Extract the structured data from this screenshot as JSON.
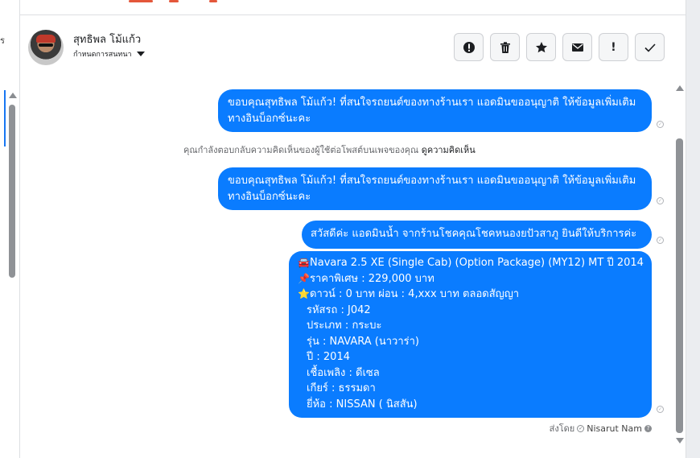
{
  "left_panel": {
    "clipped_text": "ร"
  },
  "header": {
    "user_name": "สุทธิพล โม้แก้ว",
    "assign_label": "กำหนดการสนทนา",
    "actions": [
      {
        "name": "spam-button",
        "icon": "exclamation-circle-icon"
      },
      {
        "name": "delete-button",
        "icon": "trash-icon"
      },
      {
        "name": "star-button",
        "icon": "star-icon"
      },
      {
        "name": "mark-unread-button",
        "icon": "envelope-icon"
      },
      {
        "name": "follow-up-button",
        "icon": "exclamation-icon",
        "glyph": "!"
      },
      {
        "name": "mark-done-button",
        "icon": "check-icon"
      }
    ]
  },
  "messages": {
    "m1": "ขอบคุณสุทธิพล โม้แก้ว! ที่สนใจรถยนต์ของทางร้านเรา แอดมินขออนุญาติ ให้ข้อมูลเพิ่มเติมทางอินบ็อกซ์นะคะ",
    "reply_note": "คุณกำลังตอบกลับความคิดเห็นของผู้ใช้ต่อโพสต์บนเพจของคุณ",
    "reply_link": "ดูความคิดเห็น",
    "m2": "ขอบคุณสุทธิพล โม้แก้ว! ที่สนใจรถยนต์ของทางร้านเรา แอดมินขออนุญาติ ให้ข้อมูลเพิ่มเติมทางอินบ็อกซ์นะคะ",
    "m3": "สวัสดีค่ะ แอดมินน้ำ จากร้านโชคคุณโชคหนองยปัวสาภู ยินดีให้บริการค่ะ",
    "m4": {
      "line1_emoji": "🚘",
      "line1": "Navara 2.5 XE (Single Cab) (Option Package) (MY12) MT ปี 2014",
      "line2_emoji": "📌",
      "line2": "ราคาพิเศษ : 229,000 บาท",
      "line3_emoji": "⭐",
      "line3": "ดาวน์ : 0 บาท ผ่อน : 4,xxx บาท ตลอดสัญญา",
      "details": [
        "รหัสรถ : J042",
        "ประเภท : กระบะ",
        "รุ่น : NAVARA (นาวาร่า)",
        "ปี : 2014",
        "เชื้อเพลิง : ดีเซล",
        "เกียร์ : ธรรมดา",
        "ยี่ห้อ : NISSAN ( นิสสัน)"
      ]
    },
    "sent_by_label": "ส่งโดย",
    "sent_by_name": "Nisarut Nam",
    "help_glyph": "?"
  },
  "colors": {
    "bubble": "#0a7cff",
    "accent": "#1877f2"
  }
}
